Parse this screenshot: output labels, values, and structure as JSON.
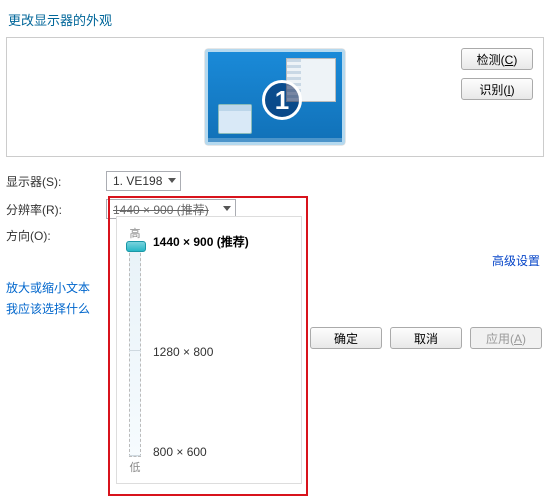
{
  "title": "更改显示器的外观",
  "preview": {
    "monitor_number": "1",
    "detect_label": "检测(",
    "detect_key": "C",
    "identify_label": "识别(",
    "identify_key": "I",
    "close_paren": ")"
  },
  "rows": {
    "display_label": "显示器(S):",
    "display_value": "1. VE198",
    "resolution_label": "分辨率(R):",
    "resolution_value": "1440 × 900 (推荐)",
    "orientation_label": "方向(O):"
  },
  "advanced_link": "高级设置",
  "links": {
    "zoom_text": "放大或缩小文本",
    "which_should": "我应该选择什么"
  },
  "footer": {
    "ok": "确定",
    "cancel": "取消",
    "apply_label": "应用(",
    "apply_key": "A",
    "apply_close": ")"
  },
  "slider": {
    "high": "高",
    "low": "低",
    "opt1": "1440 × 900 (推荐)",
    "opt2": "1280 × 800",
    "opt3": "800 × 600"
  }
}
